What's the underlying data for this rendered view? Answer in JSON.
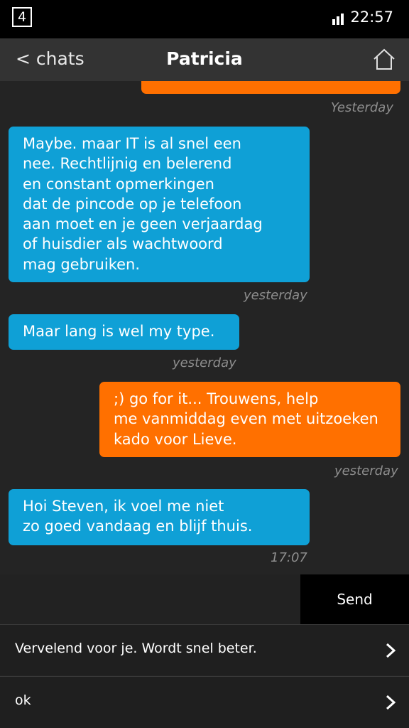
{
  "status_bar": {
    "badge": "4",
    "time": "22:57"
  },
  "header": {
    "back_label": "< chats",
    "title": "Patricia"
  },
  "messages": [
    {
      "side": "right",
      "text": "",
      "timestamp": "Yesterday"
    },
    {
      "side": "left",
      "text": "Maybe. maar IT is al snel een\nnee. Rechtlijnig en belerend\nen constant opmerkingen\ndat de pincode op je telefoon\naan moet en je geen verjaardag\nof huisdier als wachtwoord\nmag gebruiken.",
      "timestamp": "yesterday"
    },
    {
      "side": "left",
      "text": "Maar lang is wel my type.",
      "timestamp": "yesterday"
    },
    {
      "side": "right",
      "text": ";) go for it... Trouwens, help\nme vanmiddag even met uitzoeken\nkado voor Lieve.",
      "timestamp": "yesterday"
    },
    {
      "side": "left",
      "text": "Hoi Steven, ik voel me niet\nzo goed vandaag en blijf thuis.",
      "timestamp": "17:07"
    }
  ],
  "composer": {
    "input_value": "",
    "send_label": "Send"
  },
  "quick_replies": [
    {
      "label": "Vervelend voor je. Wordt snel beter."
    },
    {
      "label": "ok"
    }
  ],
  "colors": {
    "incoming": "#0fa0d6",
    "outgoing": "#ff7000",
    "background": "#242424"
  }
}
